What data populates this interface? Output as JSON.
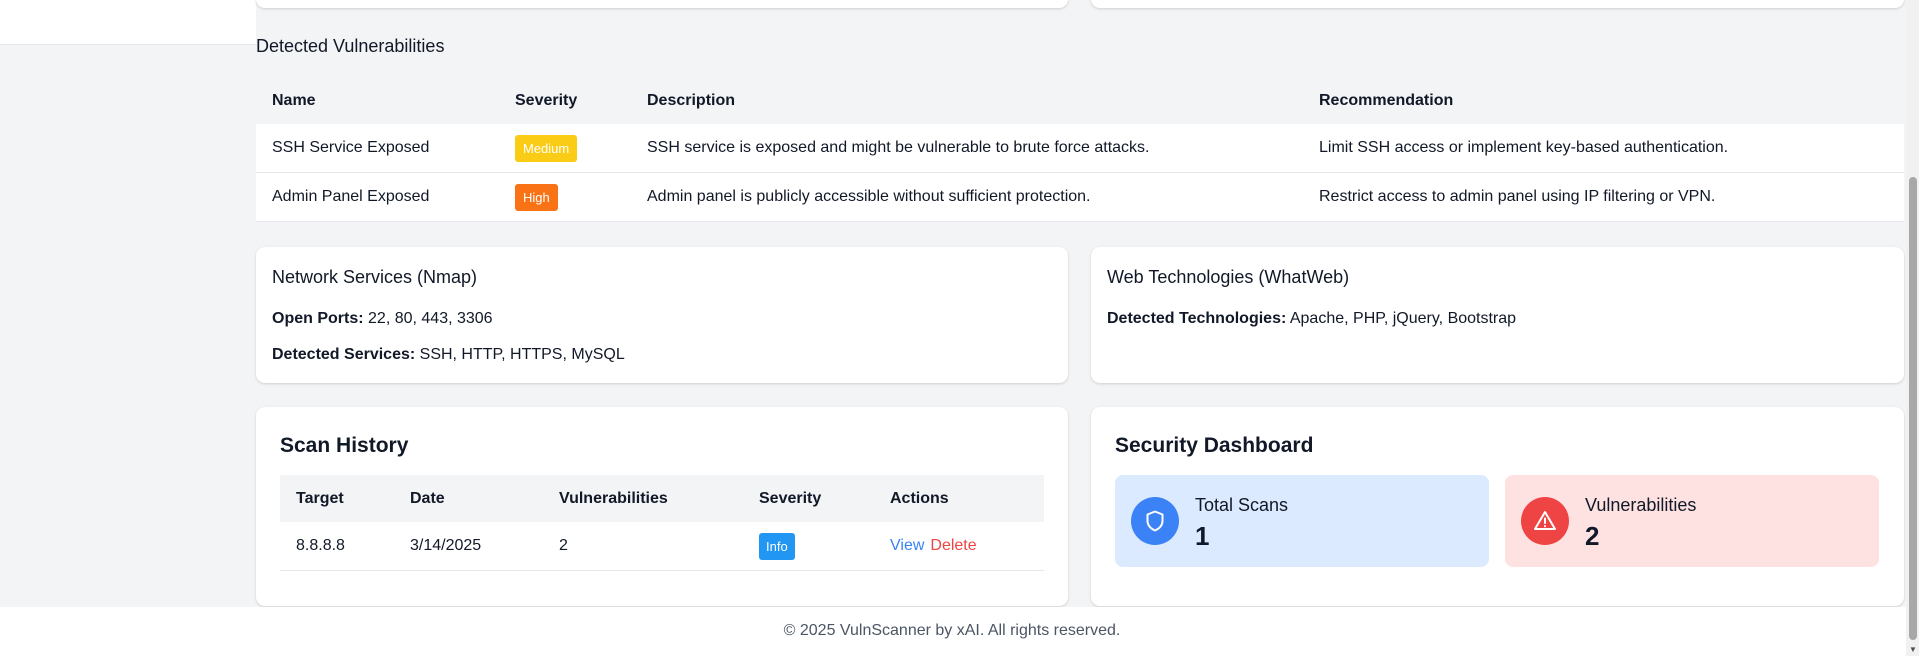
{
  "vulnerabilities": {
    "title": "Detected Vulnerabilities",
    "columns": [
      "Name",
      "Severity",
      "Description",
      "Recommendation"
    ],
    "rows": [
      {
        "name": "SSH Service Exposed",
        "severity": "Medium",
        "description": "SSH service is exposed and might be vulnerable to brute force attacks.",
        "recommendation": "Limit SSH access or implement key-based authentication."
      },
      {
        "name": "Admin Panel Exposed",
        "severity": "High",
        "description": "Admin panel is publicly accessible without sufficient protection.",
        "recommendation": "Restrict access to admin panel using IP filtering or VPN."
      }
    ]
  },
  "network": {
    "title": "Network Services (Nmap)",
    "open_ports_label": "Open Ports:",
    "open_ports_value": "22, 80, 443, 3306",
    "services_label": "Detected Services:",
    "services_value": "SSH, HTTP, HTTPS, MySQL"
  },
  "web": {
    "title": "Web Technologies (WhatWeb)",
    "tech_label": "Detected Technologies:",
    "tech_value": "Apache, PHP, jQuery, Bootstrap"
  },
  "history": {
    "title": "Scan History",
    "columns": [
      "Target",
      "Date",
      "Vulnerabilities",
      "Severity",
      "Actions"
    ],
    "rows": [
      {
        "target": "8.8.8.8",
        "date": "3/14/2025",
        "vulnerabilities": "2",
        "severity": "Info",
        "view": "View",
        "delete": "Delete"
      }
    ]
  },
  "dashboard": {
    "title": "Security Dashboard",
    "total_scans_label": "Total Scans",
    "total_scans_value": "1",
    "vulnerabilities_label": "Vulnerabilities",
    "vulnerabilities_value": "2"
  },
  "footer": {
    "text": "© 2025 VulnScanner by xAI. All rights reserved."
  },
  "colors": {
    "medium": "#facc15",
    "high": "#f97316",
    "info": "#2196f3",
    "scans_bg": "#dbeafe",
    "scans_icon": "#3b82f6",
    "vuln_bg": "#fee2e2",
    "vuln_icon": "#ef4444"
  },
  "icons": {
    "scans": "shield-icon",
    "vulnerabilities": "warning-icon"
  }
}
